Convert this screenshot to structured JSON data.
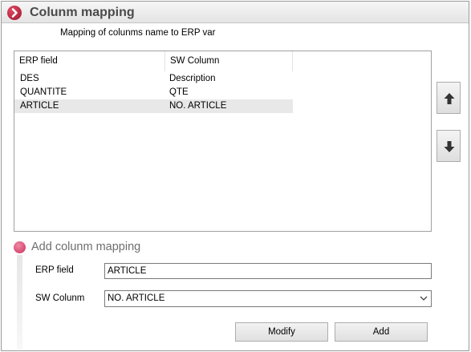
{
  "window": {
    "title": "Colunm mapping"
  },
  "subtitle": "Mapping of colunms name to ERP var",
  "mapping_list": {
    "columns": [
      "ERP field",
      "SW Column"
    ],
    "rows": [
      {
        "erp_field": "DES",
        "sw_column": "Description",
        "selected": false
      },
      {
        "erp_field": "QUANTITE",
        "sw_column": "QTE",
        "selected": false
      },
      {
        "erp_field": "ARTICLE",
        "sw_column": "NO. ARTICLE",
        "selected": true
      }
    ]
  },
  "move_buttons": {
    "up_icon": "arrow-up-icon",
    "down_icon": "arrow-down-icon"
  },
  "add_section": {
    "title": "Add colunm mapping",
    "erp_field_label": "ERP field",
    "erp_field_value": "ARTICLE",
    "sw_column_label": "SW Colunm",
    "sw_column_value": "NO. ARTICLE"
  },
  "buttons": {
    "modify_label": "Modify",
    "add_label": "Add"
  },
  "colors": {
    "accent": "#b31f3a",
    "section_dot": "#d9466f"
  }
}
